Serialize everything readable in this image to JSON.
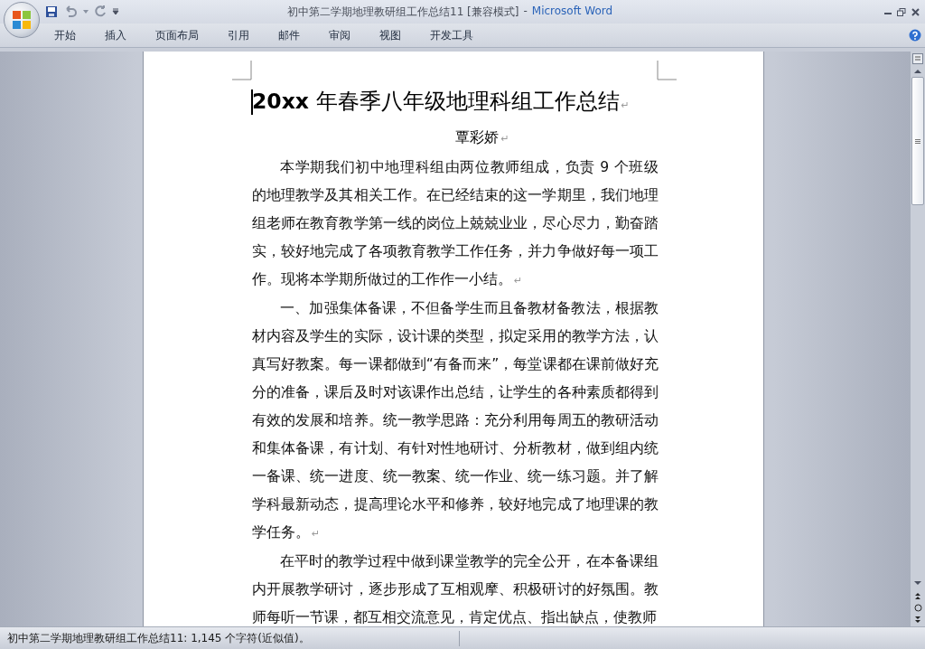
{
  "window": {
    "document_title": "初中第二学期地理教研组工作总结11 [兼容模式]",
    "separator": "-",
    "app_name": "Microsoft Word"
  },
  "ribbon_tabs": [
    {
      "label": "开始",
      "selected": false
    },
    {
      "label": "插入",
      "selected": false
    },
    {
      "label": "页面布局",
      "selected": false
    },
    {
      "label": "引用",
      "selected": false
    },
    {
      "label": "邮件",
      "selected": false
    },
    {
      "label": "审阅",
      "selected": false
    },
    {
      "label": "视图",
      "selected": false
    },
    {
      "label": "开发工具",
      "selected": false
    }
  ],
  "document": {
    "title": "**20xx** 年春季八年级地理科组工作总结",
    "author": "覃彩娇",
    "paragraph_mark": "↵",
    "paragraphs": [
      "本学期我们初中地理科组由两位教师组成，负责 9 个班级的地理教学及其相关工作。在已经结束的这一学期里，我们地理组老师在教育教学第一线的岗位上兢兢业业，尽心尽力，勤奋踏实，较好地完成了各项教育教学工作任务，并力争做好每一项工作。现将本学期所做过的工作作一小结。",
      "一、加强集体备课，不但备学生而且备教材备教法，根据教材内容及学生的实际，设计课的类型，拟定采用的教学方法，认真写好教案。每一课都做到“有备而来”，每堂课都在课前做好充分的准备，课后及时对该课作出总结，让学生的各种素质都得到有效的发展和培养。统一教学思路：充分利用每周五的教研活动和集体备课，有计划、有针对性地研讨、分析教材，做到组内统一备课、统一进度、统一教案、统一作业、统一练习题。并了解学科最新动态，提高理论水平和修养，较好地完成了地理课的教学任务。",
      "在平时的教学过程中做到课堂教学的完全公开，在本备课组内开展教学研讨，逐步形成了互相观摩、积极研讨的好氛围。教师每听一节课，都互相交流意见，肯定优点、指出缺点，使教师"
    ]
  },
  "status_bar": {
    "text": "初中第二学期地理教研组工作总结11: 1,145 个字符(近似值)。"
  }
}
